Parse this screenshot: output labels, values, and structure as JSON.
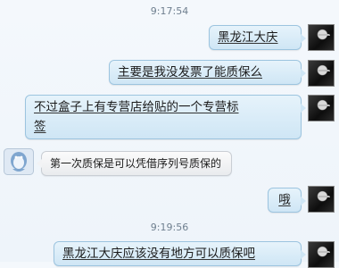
{
  "chat": {
    "timestamps": [
      "9:17:54",
      "9:19:56"
    ],
    "messages": [
      {
        "side": "me",
        "text": "黑龙江大庆"
      },
      {
        "side": "me",
        "text": "主要是我没发票了能质保么"
      },
      {
        "side": "me",
        "text_line1": "不过盒子上有专营店给贴的一个专营标",
        "text_line2": "签"
      },
      {
        "side": "them",
        "text": "第一次质保是可以凭借序列号质保的"
      },
      {
        "side": "me",
        "text": "哦"
      },
      {
        "side": "me",
        "text": "黑龙江大庆应该没有地方可以质保吧"
      }
    ]
  },
  "icons": {
    "me": "user-avatar-photo",
    "them": "qq-penguin-avatar"
  },
  "colors": {
    "mine_bubble": "#cfe6f5",
    "theirs_bubble": "#eeeff1",
    "timestamp": "#6f7f8f"
  }
}
